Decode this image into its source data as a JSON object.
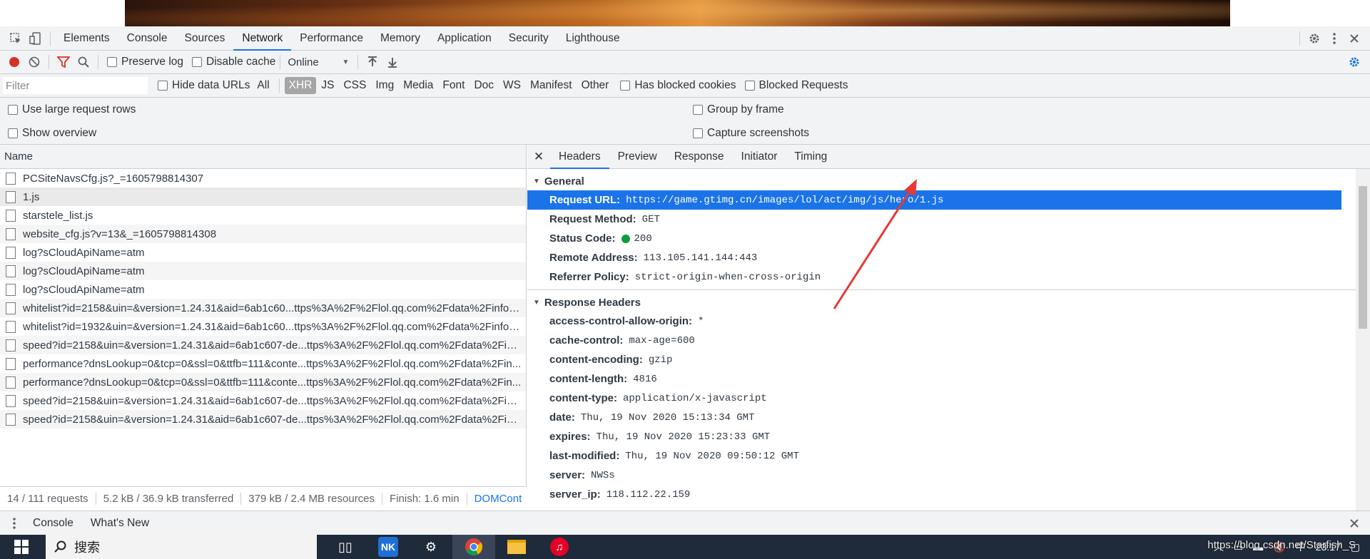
{
  "devtools": {
    "tabs": [
      "Elements",
      "Console",
      "Sources",
      "Network",
      "Performance",
      "Memory",
      "Application",
      "Security",
      "Lighthouse"
    ],
    "active_tab": "Network"
  },
  "toolbar": {
    "preserve_log": "Preserve log",
    "disable_cache": "Disable cache",
    "throttle": "Online"
  },
  "filterbar": {
    "placeholder": "Filter",
    "hide_data_urls": "Hide data URLs",
    "types": [
      "All",
      "XHR",
      "JS",
      "CSS",
      "Img",
      "Media",
      "Font",
      "Doc",
      "WS",
      "Manifest",
      "Other"
    ],
    "selected_type": "XHR",
    "has_blocked_cookies": "Has blocked cookies",
    "blocked_requests": "Blocked Requests"
  },
  "options": {
    "large_rows": "Use large request rows",
    "show_overview": "Show overview",
    "group_by_frame": "Group by frame",
    "capture_screenshots": "Capture screenshots"
  },
  "requests": {
    "header": "Name",
    "items": [
      "PCSiteNavsCfg.js?_=1605798814307",
      "1.js",
      "starstele_list.js",
      "website_cfg.js?v=13&_=1605798814308",
      "log?sCloudApiName=atm",
      "log?sCloudApiName=atm",
      "log?sCloudApiName=atm",
      "whitelist?id=2158&uin=&version=1.24.31&aid=6ab1c60...ttps%3A%2F%2Flol.qq.com%2Fdata%2Finfo-h...",
      "whitelist?id=1932&uin=&version=1.24.31&aid=6ab1c60...ttps%3A%2F%2Flol.qq.com%2Fdata%2Finfo-h...",
      "speed?id=2158&uin=&version=1.24.31&aid=6ab1c607-de...ttps%3A%2F%2Flol.qq.com%2Fdata%2Finf...",
      "performance?dnsLookup=0&tcp=0&ssl=0&ttfb=111&conte...ttps%3A%2F%2Flol.qq.com%2Fdata%2Fin...",
      "performance?dnsLookup=0&tcp=0&ssl=0&ttfb=111&conte...ttps%3A%2F%2Flol.qq.com%2Fdata%2Fin...",
      "speed?id=2158&uin=&version=1.24.31&aid=6ab1c607-de...ttps%3A%2F%2Flol.qq.com%2Fdata%2Finf...",
      "speed?id=2158&uin=&version=1.24.31&aid=6ab1c607-de...ttps%3A%2F%2Flol.qq.com%2Fdata%2Finf..."
    ]
  },
  "statusbar": {
    "requests": "14 / 111 requests",
    "transferred": "5.2 kB / 36.9 kB transferred",
    "resources": "379 kB / 2.4 MB resources",
    "finish": "Finish: 1.6 min",
    "domcont": "DOMCont"
  },
  "details": {
    "tabs": [
      "Headers",
      "Preview",
      "Response",
      "Initiator",
      "Timing"
    ],
    "active_tab": "Headers",
    "general_title": "General",
    "general": [
      {
        "k": "Request URL:",
        "v": "https://game.gtimg.cn/images/lol/act/img/js/hero/1.js"
      },
      {
        "k": "Request Method:",
        "v": "GET"
      },
      {
        "k": "Status Code:",
        "v": "200"
      },
      {
        "k": "Remote Address:",
        "v": "113.105.141.144:443"
      },
      {
        "k": "Referrer Policy:",
        "v": "strict-origin-when-cross-origin"
      }
    ],
    "response_title": "Response Headers",
    "response": [
      {
        "k": "access-control-allow-origin:",
        "v": "*"
      },
      {
        "k": "cache-control:",
        "v": "max-age=600"
      },
      {
        "k": "content-encoding:",
        "v": "gzip"
      },
      {
        "k": "content-length:",
        "v": "4816"
      },
      {
        "k": "content-type:",
        "v": "application/x-javascript"
      },
      {
        "k": "date:",
        "v": "Thu, 19 Nov 2020 15:13:34 GMT"
      },
      {
        "k": "expires:",
        "v": "Thu, 19 Nov 2020 15:23:33 GMT"
      },
      {
        "k": "last-modified:",
        "v": "Thu, 19 Nov 2020 09:50:12 GMT"
      },
      {
        "k": "server:",
        "v": "NWSs"
      },
      {
        "k": "server_ip:",
        "v": "118.112.22.159"
      }
    ]
  },
  "drawer": {
    "console": "Console",
    "whats_new": "What's New"
  },
  "taskbar": {
    "search": "搜索",
    "time": "23:17",
    "watermark": "https://blog.csdn.net/Starfish_S",
    "ime": "中"
  },
  "colors": {
    "accent": "#1a73e8",
    "record": "#d93025",
    "status_ok": "#0a9d3a",
    "arrow": "#e53935"
  }
}
